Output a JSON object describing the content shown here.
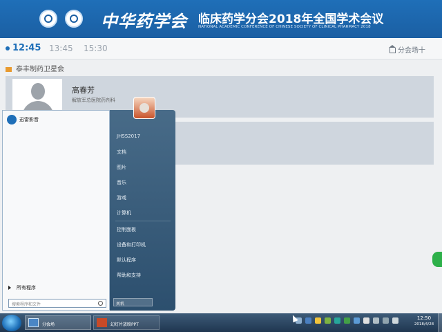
{
  "header": {
    "calligraphy": "中华药学会",
    "title": "临床药学分会2018年全国学术会议",
    "subtitle": "NATIONAL ACADEMIC CONFERENCE OF CHINESE SOCIETY OF CLINICAL PHARMACY 2018"
  },
  "schedule": {
    "times": [
      "12:45",
      "13:45",
      "15:30"
    ],
    "venue_label": "分会场十",
    "session_title": "泰丰制药卫星会",
    "speakers": [
      {
        "name": "高春芳",
        "affiliation": "解放军总医院药剂科"
      }
    ]
  },
  "start_menu": {
    "pinned_item": "迅雷影音",
    "all_programs": "所有程序",
    "search_placeholder": "搜索程序和文件",
    "right_items": [
      "JHSS2017",
      "文档",
      "图片",
      "音乐",
      "游戏",
      "计算机",
      "控制面板",
      "设备和打印机",
      "默认程序",
      "帮助和支持"
    ],
    "shutdown_label": "关机"
  },
  "taskbar": {
    "items": [
      "分会场",
      "幻灯片放映PPT"
    ],
    "clock_time": "12:50",
    "clock_date": "2018/4/28"
  },
  "colors": {
    "banner": "#1f6fb8",
    "card": "#cfd6de",
    "active_time": "#1f6fb8"
  }
}
